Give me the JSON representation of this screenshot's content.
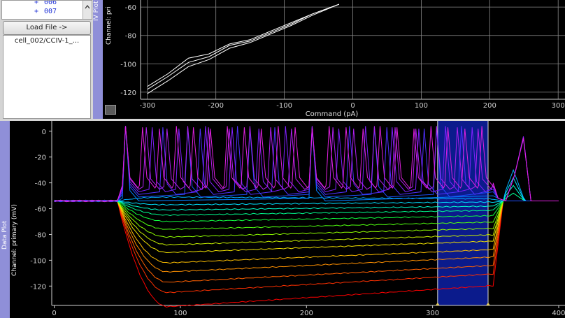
{
  "file_browser": {
    "tree_items": [
      {
        "expander": "+",
        "label": "006"
      },
      {
        "expander": "+",
        "label": "007"
      }
    ],
    "scroll_icon": "up-arrow-icon"
  },
  "load_file_button": "Load File ->",
  "loaded_file": "cell_002/CCIV-1_...",
  "iv_plot": {
    "dock_title": "IV Plot",
    "ylabel": "Channel: pri",
    "xlabel": "Command (pA)",
    "xticks": [
      "-300",
      "-200",
      "-100",
      "0",
      "100",
      "200",
      "300"
    ],
    "yticks": [
      "-60",
      "-80",
      "-100",
      "-120"
    ]
  },
  "data_plot": {
    "dock_title": "Data Plot",
    "ylabel": "Channel: primary (mV)",
    "xticks": [
      "0",
      "100",
      "200",
      "300",
      "400"
    ],
    "yticks": [
      "0",
      "-20",
      "-40",
      "-60",
      "-80",
      "-100",
      "-120"
    ]
  },
  "colors": {
    "dock_tab": "#8f8fd8",
    "region": "#0b1b8c",
    "plot_bg": "#000000"
  },
  "chart_data": [
    {
      "type": "line",
      "xlabel": "Command (pA)",
      "ylabel": "Channel: pri",
      "xlim": [
        -310,
        310
      ],
      "ylim": [
        -125,
        -55
      ],
      "series": [
        {
          "x": [
            -300,
            -270,
            -240,
            -210,
            -180,
            -150,
            -120,
            -90,
            -60,
            -20
          ],
          "y": [
            -121,
            -112,
            -102,
            -97,
            -89,
            -85,
            -79,
            -73,
            -66,
            -58
          ]
        },
        {
          "x": [
            -300,
            -270,
            -240,
            -210,
            -180,
            -150,
            -120,
            -90,
            -60,
            -20
          ],
          "y": [
            -118,
            -109,
            -99,
            -95,
            -87,
            -84,
            -78,
            -72,
            -65,
            -58
          ]
        },
        {
          "x": [
            -300,
            -270,
            -240,
            -210,
            -180,
            -150,
            -120,
            -90,
            -60,
            -20
          ],
          "y": [
            -116,
            -107,
            -96,
            -93,
            -86,
            -83,
            -77,
            -71,
            -65,
            -58
          ]
        }
      ]
    },
    {
      "type": "line",
      "ylabel": "Channel: primary (mV)",
      "xlim": [
        -2,
        405
      ],
      "ylim": [
        -135,
        8
      ],
      "region": [
        304,
        344
      ],
      "baseline": -54,
      "steady_levels": [
        -134,
        -123,
        -115,
        -107,
        -100,
        -92,
        -86,
        -80,
        -74,
        -68,
        -63,
        -59,
        -55,
        -52,
        -50,
        -47,
        -45,
        -43,
        -41,
        -40
      ],
      "spike_counts": [
        0,
        0,
        0,
        0,
        0,
        0,
        0,
        0,
        0,
        0,
        0,
        0,
        0,
        0,
        2,
        6,
        10,
        14,
        18,
        22
      ],
      "colors": [
        "#ff0000",
        "#ff3000",
        "#ff6000",
        "#ff9000",
        "#ffc000",
        "#f0e000",
        "#c8f000",
        "#90ff00",
        "#50ff10",
        "#10ff40",
        "#00ff90",
        "#00ffd0",
        "#00e0ff",
        "#00b0ff",
        "#0080ff",
        "#2050ff",
        "#5030ff",
        "#8020ff",
        "#b020f0",
        "#e020e0"
      ]
    }
  ]
}
